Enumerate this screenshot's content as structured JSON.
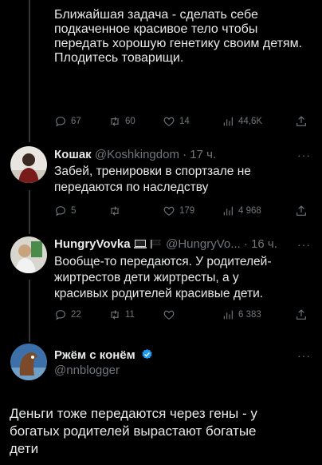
{
  "tweet1": {
    "text": "Ближайшая задача - сделать себе\nподкаченное красивое тело чтобы\nпередать хорошую генетику своим\nдетям.\n\nПлодитесь товарищи.",
    "replies": "67",
    "retweets": "60",
    "likes": "14",
    "views": "44,6K"
  },
  "tweet2": {
    "name": "Кошак",
    "handle": "@Koshkingdom · 17 ч.",
    "text": "Забей, тренировки в спортзале не\nпередаются по наследству",
    "replies": "5",
    "retweets": "",
    "likes": "179",
    "views": "4 968"
  },
  "tweet3": {
    "name": "HungryVovka",
    "handle": "@HungryVo... · 16 ч.",
    "text": "Вообще-то передаются. У родителей-\nжиртрестов дети жиртресты, а у\nкрасивых родителей красивые дети.",
    "replies": "22",
    "retweets": "11",
    "likes": "",
    "views": "6 383"
  },
  "tweet4": {
    "name": "Ржём с конём",
    "handle": "@nnblogger",
    "text": "Деньги тоже передаются через гены - у\nбогатых родителей вырастают богатые\nдети"
  },
  "more_label": "···",
  "colors": {
    "accent": "#1d9bf0",
    "muted": "#71767b",
    "text": "#e7e9ea",
    "background": "#000000"
  }
}
